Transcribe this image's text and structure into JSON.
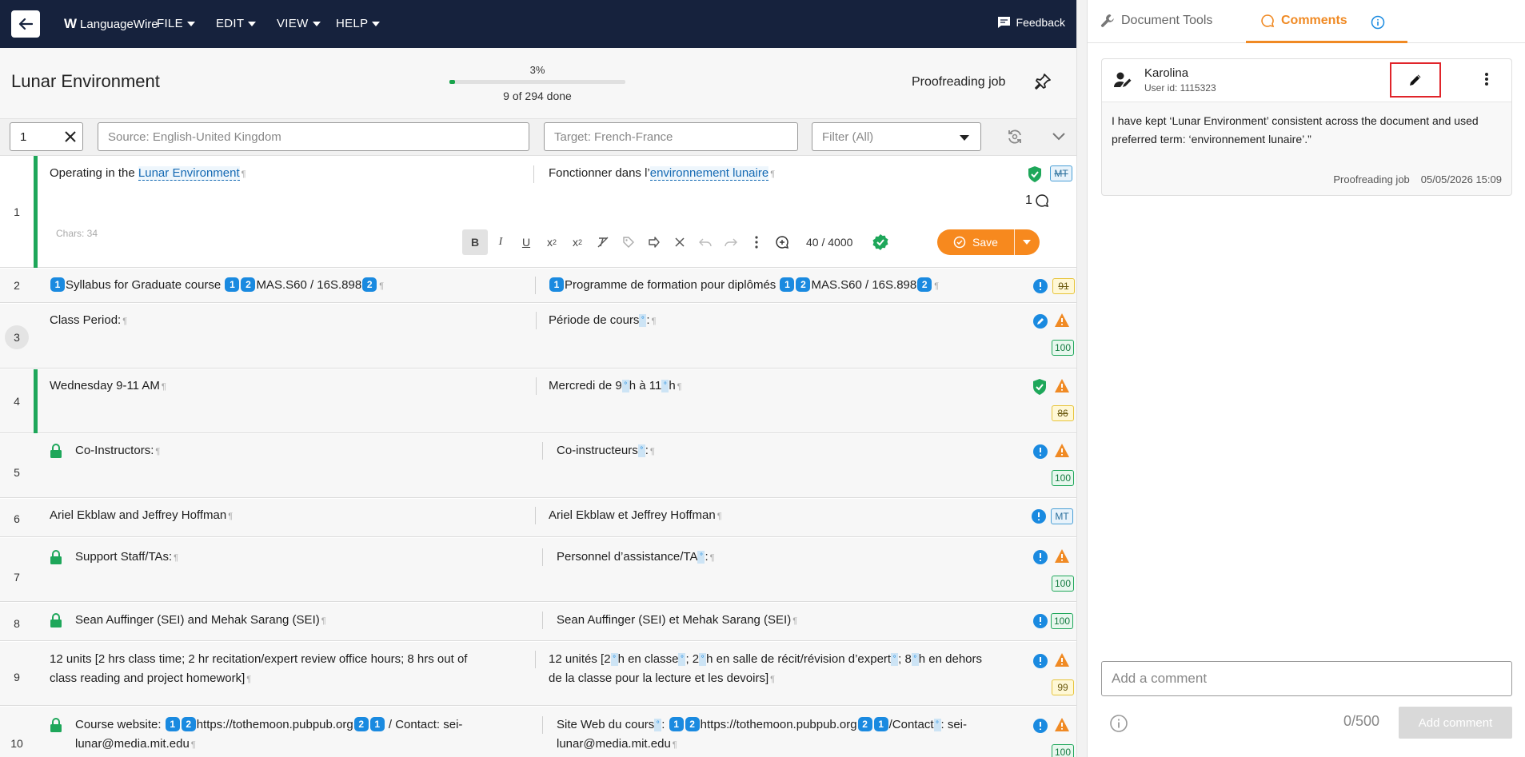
{
  "topbar": {
    "brand": "LanguageWire",
    "menus": [
      "FILE",
      "EDIT",
      "VIEW",
      "HELP"
    ],
    "feedback": "Feedback"
  },
  "doc": {
    "title": "Lunar Environment",
    "progress_pct_label": "3%",
    "progress_pct": 3,
    "progress_done": "9 of 294 done",
    "job_type": "Proofreading job"
  },
  "filters": {
    "segment": "1",
    "source_placeholder": "Source: English-United Kingdom",
    "target_placeholder": "Target: French-France",
    "filter_placeholder": "Filter (All)"
  },
  "editor": {
    "chars": "Chars: 34",
    "count": "40 / 4000",
    "save_label": "Save"
  },
  "segments": [
    {
      "num": "1",
      "src_a": "Operating in the ",
      "src_term": "Lunar Environment",
      "tgt_a": "Fonctionner dans l’",
      "tgt_term": "environnement lunaire",
      "badge": "MT",
      "comments": "1"
    },
    {
      "num": "2",
      "src_text": "Syllabus for Graduate course ",
      "src_tail": "MAS.S60 / 16S.898",
      "tgt_text": "Programme de formation pour diplômés ",
      "tgt_tail": "MAS.S60 / 16S.898",
      "badge": "91"
    },
    {
      "num": "3",
      "src": "Class Period:",
      "tgt_a": "Période de cours",
      "tgt_b": ":",
      "badge": "100"
    },
    {
      "num": "4",
      "src": "Wednesday 9-11 AM",
      "tgt_a": "Mercredi de 9",
      "tgt_b": "h à 11",
      "tgt_c": "h",
      "badge": "86"
    },
    {
      "num": "5",
      "src": "Co-Instructors:",
      "tgt_a": "Co-instructeurs",
      "tgt_b": ":",
      "badge": "100"
    },
    {
      "num": "6",
      "src": "Ariel Ekblaw and Jeffrey Hoffman",
      "tgt": "Ariel Ekblaw et Jeffrey Hoffman",
      "badge": "MT"
    },
    {
      "num": "7",
      "src": "Support Staff/TAs:",
      "tgt_a": "Personnel d’assistance/TA",
      "tgt_b": ":",
      "badge": "100"
    },
    {
      "num": "8",
      "src": "Sean Auffinger (SEI) and Mehak Sarang (SEI)",
      "tgt": "Sean Auffinger (SEI) et Mehak Sarang (SEI)",
      "badge": "100"
    },
    {
      "num": "9",
      "src_l1": "12 units [2 hrs class time; 2 hr recitation/expert review office hours; 8 hrs out of",
      "src_l2": "class reading and project homework]",
      "tgt_l1a": "12 unités [2",
      "tgt_l1b": "h en classe",
      "tgt_l1c": "; 2",
      "tgt_l1d": "h en salle de récit/révision d’expert",
      "tgt_l1e": "; 8",
      "tgt_l1f": "h en dehors",
      "tgt_l2": "de la classe pour la lecture et les devoirs]",
      "badge": "99"
    },
    {
      "num": "10",
      "src_a": "Course website: ",
      "src_url": "https://tothemoon.pubpub.org",
      "src_b": " / Contact: sei-",
      "src_l2": "lunar@media.mit.edu",
      "tgt_a": "Site Web du cours",
      "tgt_b": ": ",
      "tgt_url": "https://tothemoon.pubpub.org",
      "tgt_c": "/Contact",
      "tgt_d": ": sei-",
      "tgt_l2": "lunar@media.mit.edu",
      "badge": "100"
    }
  ],
  "tags": {
    "one": "1",
    "two": "2"
  },
  "side": {
    "tab_tools": "Document Tools",
    "tab_comments": "Comments",
    "comment": {
      "name": "Karolina",
      "uid": "User id: 1115323",
      "text": "I have kept ‘Lunar Environment’ consistent across the document and used preferred term: ‘environnement lunaire’.”",
      "job": "Proofreading job",
      "date": "05/05/2026 15:09"
    },
    "add_placeholder": "Add a comment",
    "counter": "0/500",
    "add_button": "Add comment"
  },
  "colors": {
    "nav": "#16223d",
    "accent": "#f08a24",
    "green": "#1ea75a",
    "blue": "#1a8ae0",
    "warn": "#f08a24"
  }
}
